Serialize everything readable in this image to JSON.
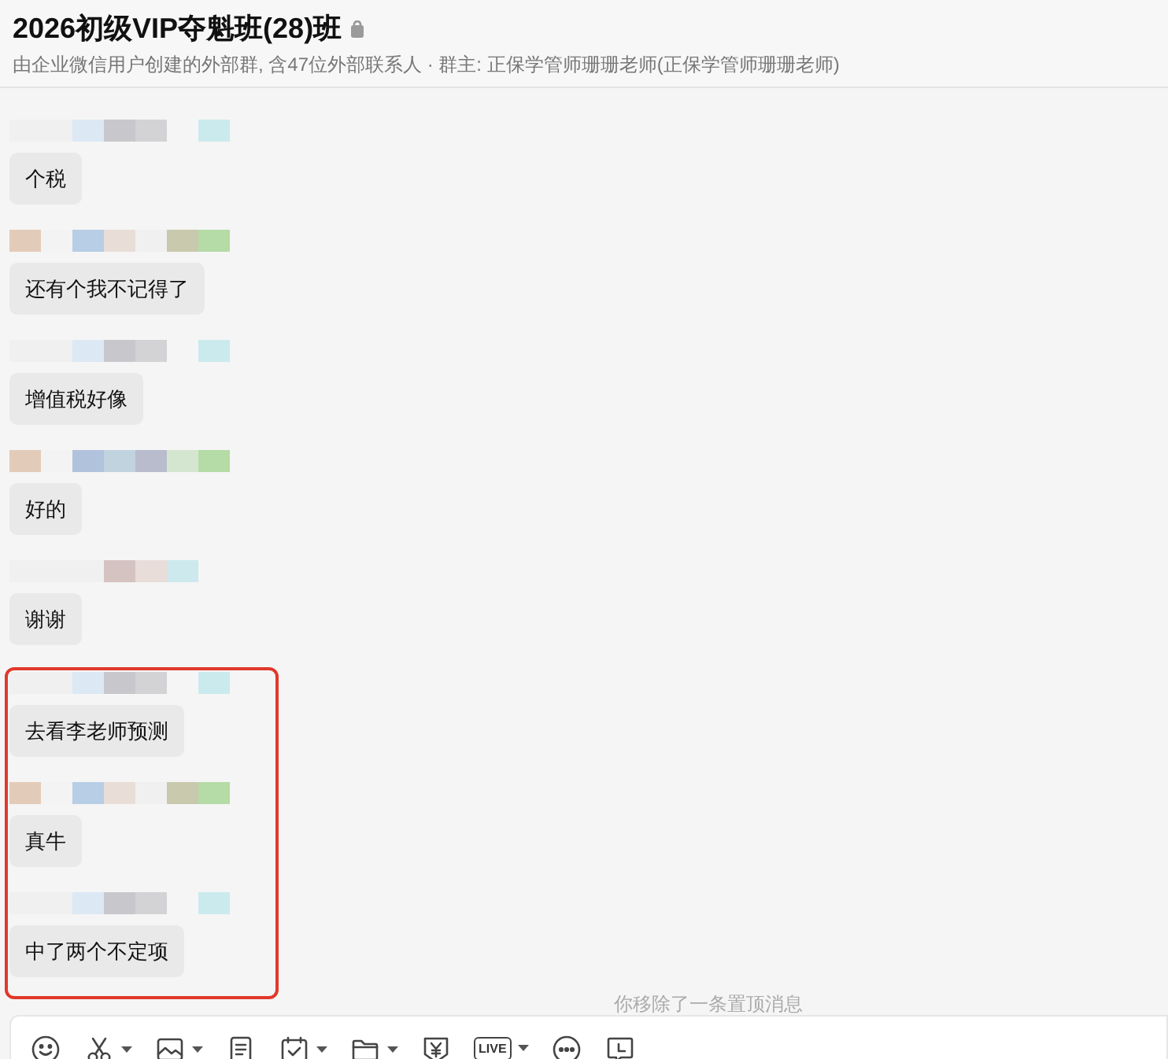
{
  "header": {
    "title": "2026初级VIP夺魁班(28)班",
    "subtitle": "由企业微信用户创建的外部群, 含47位外部联系人 · 群主: 正保学管师珊珊老师(正保学管师珊珊老师)"
  },
  "messages": [
    {
      "text": "个税",
      "highlighted": false
    },
    {
      "text": "还有个我不记得了",
      "highlighted": false
    },
    {
      "text": "增值税好像",
      "highlighted": false
    },
    {
      "text": "好的",
      "highlighted": false
    },
    {
      "text": "谢谢",
      "highlighted": false
    },
    {
      "text": "去看李老师预测",
      "highlighted": true
    },
    {
      "text": "真牛",
      "highlighted": true
    },
    {
      "text": "中了两个不定项",
      "highlighted": true
    }
  ],
  "notice": "你移除了一条置顶消息",
  "toolbar": [
    {
      "kind": "emoji",
      "menu": false
    },
    {
      "kind": "scissors",
      "menu": true
    },
    {
      "kind": "image",
      "menu": true
    },
    {
      "kind": "document",
      "menu": false
    },
    {
      "kind": "calendar",
      "menu": true
    },
    {
      "kind": "folder",
      "menu": true
    },
    {
      "kind": "yen",
      "menu": false
    },
    {
      "kind": "live",
      "label": "LIVE",
      "menu": true
    },
    {
      "kind": "more",
      "menu": false
    },
    {
      "kind": "clock",
      "menu": false
    }
  ]
}
